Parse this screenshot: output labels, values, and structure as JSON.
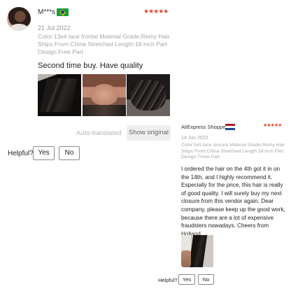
{
  "review1": {
    "author": "M***s",
    "country_flag": "brazil-flag",
    "rating_stars": "★★★★★",
    "rating": 5,
    "date": "21 Jul 2022",
    "attributes": "Color:13x4 lace frontal Material Grade:Remy Hair Ships From:China Stretched Length:18 inch Part Design:Free Part",
    "text": "Second time buy. Have quality",
    "photos": [
      "review-photo-1",
      "review-photo-2",
      "review-photo-3"
    ],
    "auto_translated": "Auto-translated",
    "show_original": "Show original",
    "helpful_label": "Helpful?",
    "yes_label": "Yes",
    "no_label": "No"
  },
  "review2": {
    "author": "AliExpress Shopper",
    "country_flag": "netherlands-flag",
    "rating_stars": "★★★★★",
    "rating": 5,
    "date": "14 Jun 2022",
    "attributes": "Color:5x5 lace closure Material Grade:Remy Hair Ships From:China Stretched Length:18 inch Part Design:Three Part",
    "text": "I ordered the hair on the 4th got it in on the 14th, and I highly recommend it. Especially for the price, this hair is really of good quality. I will surely buy my next closure from this vendor again. Dear company, please keep up the good work, because there are a lot of expensive fraudsters nowadays. Cheers from Holland.",
    "photos": [
      "review-photo"
    ],
    "helpful_label": "Helpful?",
    "yes_label": "Yes",
    "no_label": "No"
  },
  "colors": {
    "star": "#e6442c",
    "muted_text": "#a6a6a6",
    "button_border": "#8a8a8a"
  }
}
